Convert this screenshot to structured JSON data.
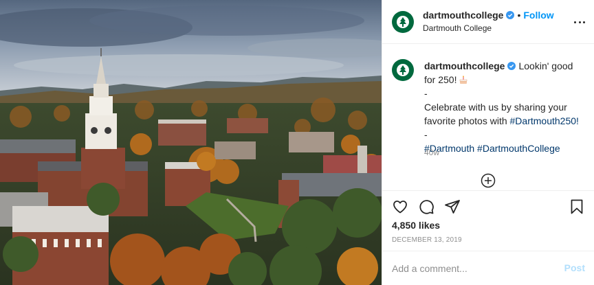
{
  "account": {
    "username": "dartmouthcollege",
    "separator": "•",
    "follow_label": "Follow",
    "location": "Dartmouth College"
  },
  "caption": {
    "username": "dartmouthcollege",
    "line1": "Lookin' good",
    "line2": "for 250!",
    "line3": "-",
    "line4": "Celebrate with us by sharing your",
    "line5_text": "favorite photos with ",
    "line5_hashtag": "#Dartmouth250!",
    "line6": "-",
    "hashtag1": "#Dartmouth",
    "hashtag2": "#DartmouthCollege",
    "age": "40w"
  },
  "stats": {
    "likes": "4,850 likes",
    "date": "DECEMBER 13, 2019"
  },
  "comment": {
    "placeholder": "Add a comment...",
    "post_label": "Post"
  },
  "colors": {
    "brand_green": "#00693e",
    "follow_blue": "#0095f6",
    "hashtag_blue": "#00376b",
    "post_disabled": "#b2dffc"
  },
  "icons": {
    "verified": "verified-badge-icon",
    "like": "heart-icon",
    "comment": "comment-bubble-icon",
    "share": "paper-plane-icon",
    "save": "bookmark-icon",
    "more": "more-options-icon",
    "load_more": "plus-circle-icon"
  }
}
